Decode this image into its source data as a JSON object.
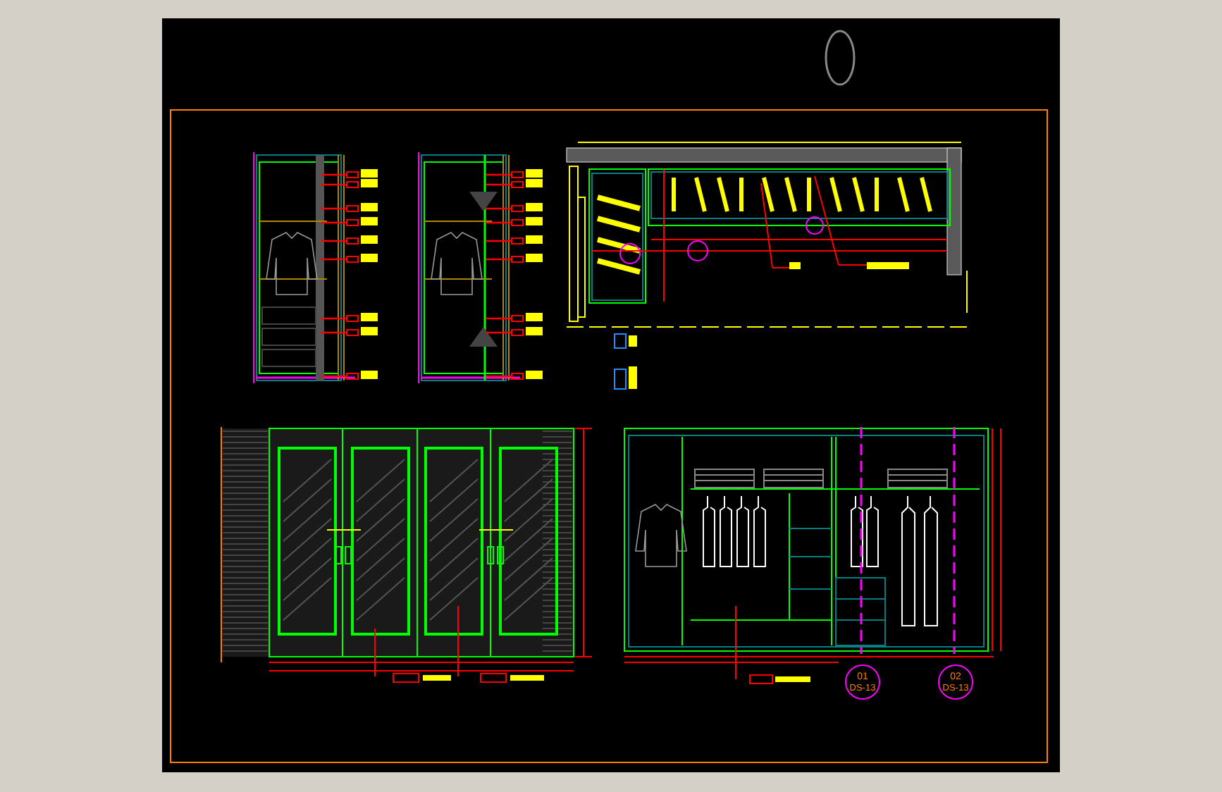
{
  "drawing": {
    "callouts": [
      {
        "number": "01",
        "sheet": "DS-13"
      },
      {
        "number": "02",
        "sheet": "DS-13"
      }
    ]
  }
}
